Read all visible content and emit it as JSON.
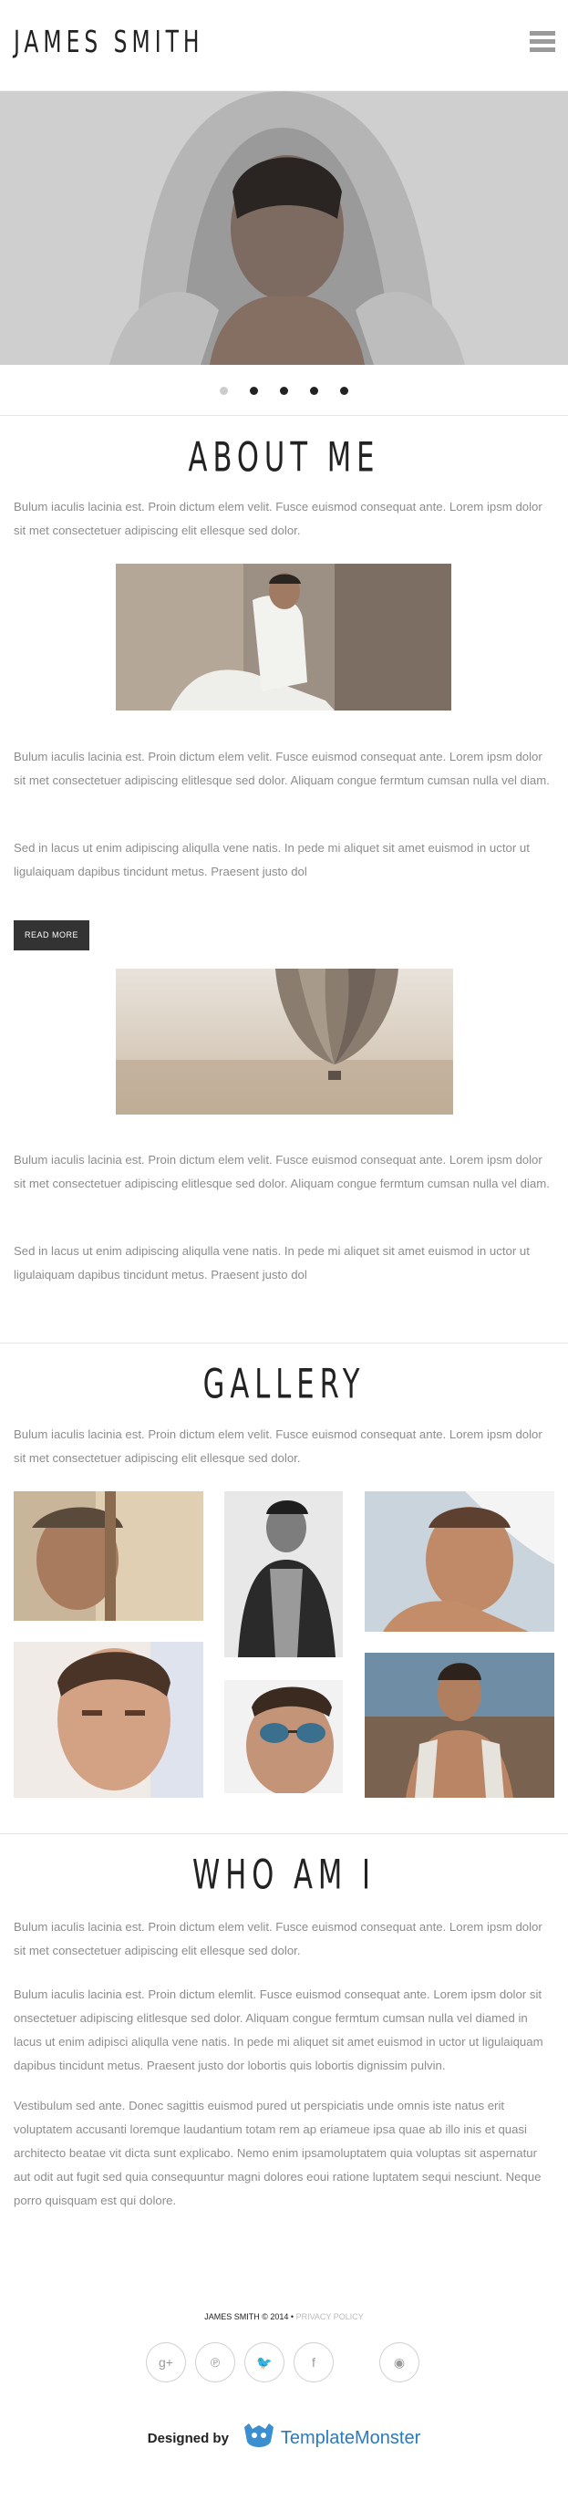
{
  "header": {
    "logo": "JAMES SMITH"
  },
  "slider": {
    "dots": 5,
    "active": 0
  },
  "about": {
    "title": "ABOUT ME",
    "intro": "Bulum iaculis lacinia est. Proin dictum elem velit. Fusce euismod consequat ante. Lorem ipsm dolor sit met consectetuer adipiscing elit ellesque sed dolor.",
    "p1": "Bulum iaculis lacinia est. Proin dictum elem velit. Fusce euismod consequat ante. Lorem ipsm dolor sit met consectetuer adipiscing elitlesque sed dolor. Aliquam congue fermtum cumsan nulla vel diam.",
    "p2": "Sed in lacus ut enim adipiscing aliqulla vene natis. In pede mi aliquet sit amet euismod in uctor ut ligulaiquam dapibus tincidunt metus. Praesent justo dol",
    "button": "READ MORE",
    "p3": "Bulum iaculis lacinia est. Proin dictum elem velit. Fusce euismod consequat ante. Lorem ipsm dolor sit met consectetuer adipiscing elitlesque sed dolor. Aliquam congue fermtum cumsan nulla vel diam.",
    "p4": "Sed in lacus ut enim adipiscing aliqulla vene natis. In pede mi aliquet sit amet euismod in uctor ut ligulaiquam dapibus tincidunt metus. Praesent justo dol"
  },
  "gallery": {
    "title": "GALLERY",
    "intro": "Bulum iaculis lacinia est. Proin dictum elem velit. Fusce euismod consequat ante. Lorem ipsm dolor sit met consectetuer adipiscing elit ellesque sed dolor."
  },
  "whoami": {
    "title": "WHO AM I",
    "p1": "Bulum iaculis lacinia est. Proin dictum elem velit. Fusce euismod consequat ante. Lorem ipsm dolor sit met consectetuer adipiscing elit ellesque sed dolor.",
    "p2": "Bulum iaculis lacinia est. Proin dictum elemlit. Fusce euismod consequat ante. Lorem ipsm dolor sit onsectetuer adipiscing elitlesque sed dolor. Aliquam congue fermtum cumsan nulla vel diamed in lacus ut enim adipisci aliqulla vene natis. In pede mi aliquet sit amet euismod in uctor ut ligulaiquam dapibus tincidunt metus. Praesent justo dor lobortis quis lobortis dignissim pulvin.",
    "p3": "Vestibulum sed ante. Donec sagittis euismod pured ut perspiciatis unde omnis iste natus erit voluptatem accusanti loremque laudantium totam rem ap eriameue ipsa quae ab illo inis et quasi architecto beatae vit dicta sunt explicabo. Nemo enim ipsamoluptatem quia voluptas sit aspernatur aut odit aut fugit sed quia consequuntur magni dolores eoui ratione luptatem sequi nesciunt. Neque porro quisquam est qui dolore."
  },
  "footer": {
    "copyright": "JAMES SMITH © 2014 •",
    "privacy": "PRIVACY POLICY",
    "social": [
      {
        "icon": "google-plus-icon",
        "glyph": "g+"
      },
      {
        "icon": "pinterest-icon",
        "glyph": "℗"
      },
      {
        "icon": "twitter-icon",
        "glyph": "🐦"
      },
      {
        "icon": "facebook-icon",
        "glyph": "f"
      },
      {
        "icon": "dribbble-icon",
        "glyph": "◉"
      }
    ],
    "designed_by": "Designed by",
    "brand": "TemplateMonster"
  }
}
